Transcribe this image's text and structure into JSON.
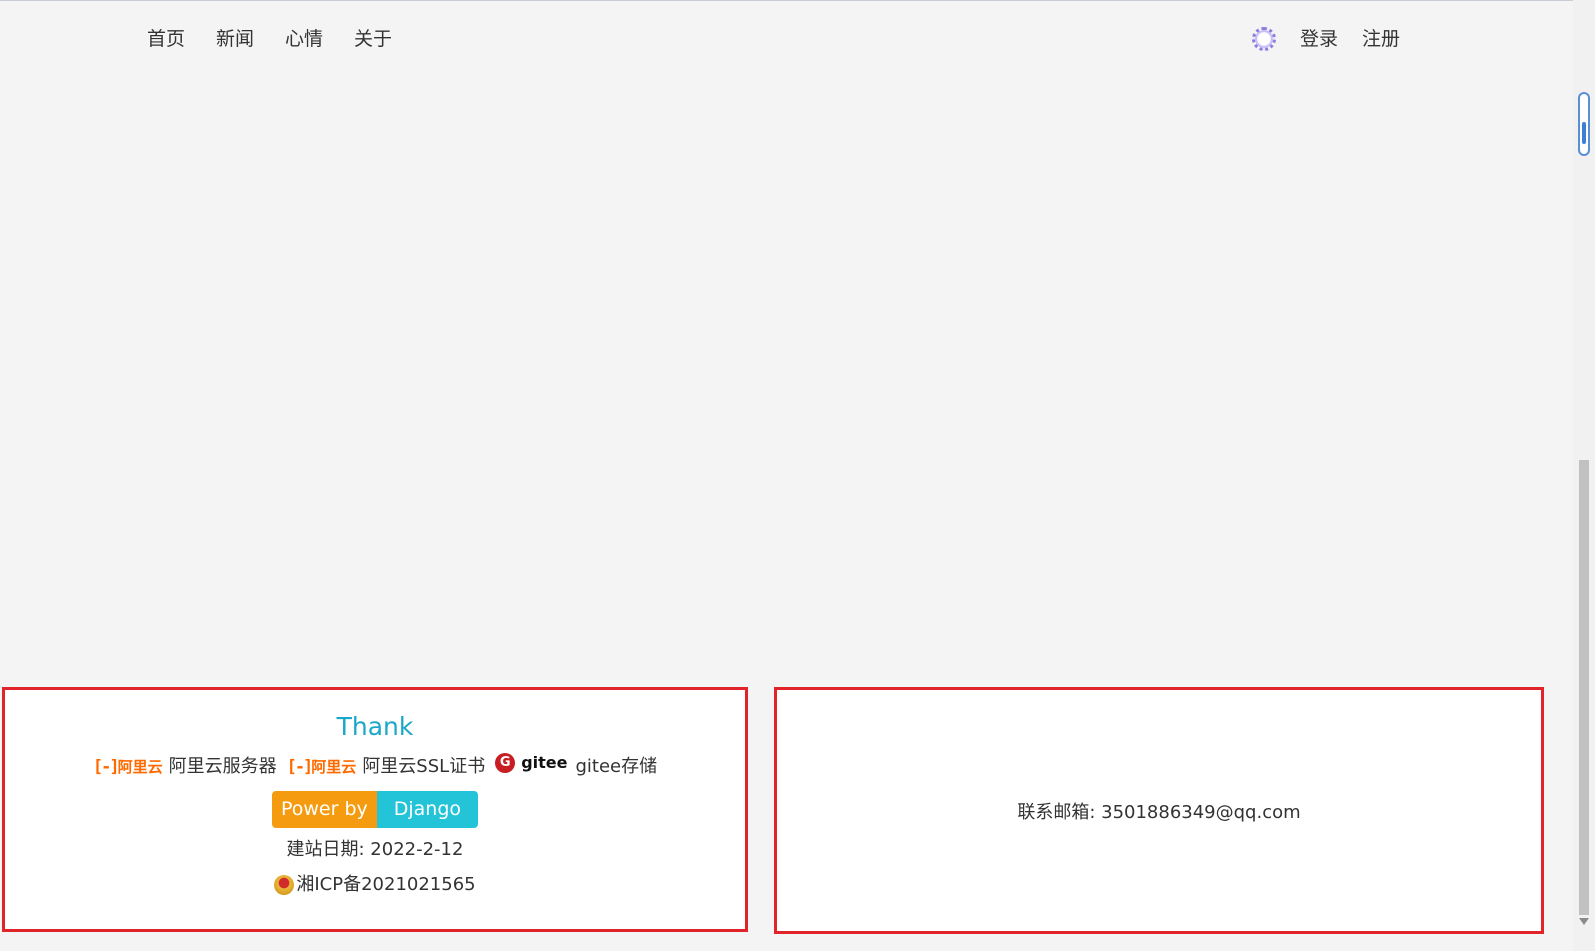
{
  "nav": {
    "left": [
      "首页",
      "新闻",
      "心情",
      "关于"
    ],
    "login": "登录",
    "register": "注册"
  },
  "footer": {
    "thank": "Thank",
    "sponsors": {
      "aliyun_logo_text": "阿里云",
      "aliyun_server": "阿里云服务器",
      "aliyun_ssl": "阿里云SSL证书",
      "gitee_logo_text": "gitee",
      "gitee_storage": "gitee存储"
    },
    "powered_by": "Power by",
    "framework": "Django",
    "build_date": "建站日期: 2022-2-12",
    "icp": "湘ICP备2021021565",
    "contact": "联系邮箱: 3501886349@qq.com"
  }
}
